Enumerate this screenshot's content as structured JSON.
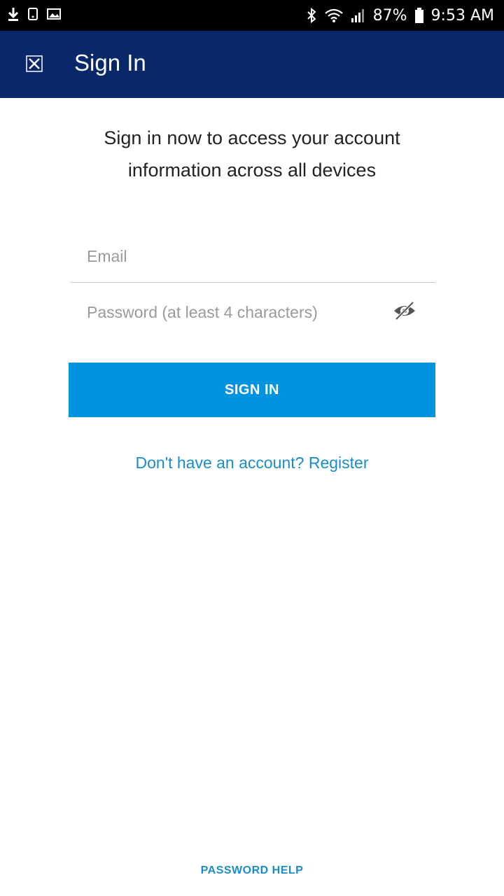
{
  "status_bar": {
    "battery": "87%",
    "time": "9:53 AM",
    "icons": [
      "download-icon",
      "notification-icon",
      "image-icon",
      "bluetooth-icon",
      "wifi-icon",
      "signal-icon",
      "battery-icon"
    ]
  },
  "app_bar": {
    "title": "Sign In",
    "close_icon": "close-icon",
    "background": "#082869"
  },
  "intro": {
    "line1": "Sign in now to access your account",
    "line2": "information across all devices"
  },
  "form": {
    "email_placeholder": "Email",
    "email_value": "",
    "password_placeholder": "Password (at least 4 characters)",
    "password_value": "",
    "toggle_icon": "eye-off-icon"
  },
  "actions": {
    "sign_in_label": "SIGN IN",
    "sign_in_color": "#0093e0",
    "register_text": "Don't have an account? Register",
    "password_help": "PASSWORD HELP",
    "link_color": "#1a8ccc"
  }
}
